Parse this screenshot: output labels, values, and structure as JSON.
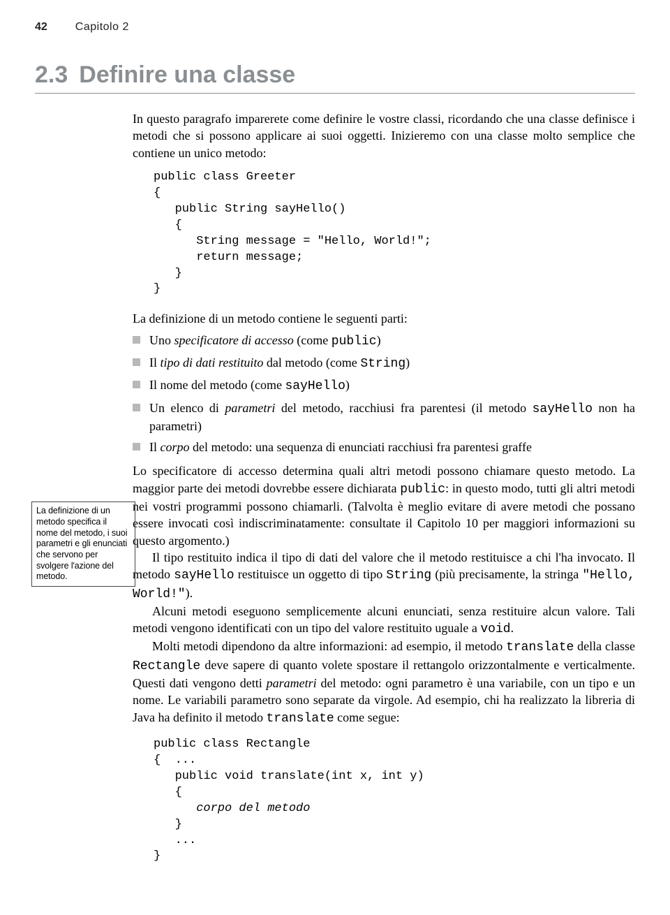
{
  "header": {
    "page_number": "42",
    "chapter": "Capitolo 2"
  },
  "section": {
    "number": "2.3",
    "title": "Definire una classe"
  },
  "intro": "In questo paragrafo imparerete come definire le vostre classi, ricordando che una classe definisce i metodi che si possono applicare ai suoi oggetti. Inizieremo con una classe molto semplice che contiene un unico metodo:",
  "code1": "public class Greeter\n{\n   public String sayHello()\n   {\n      String message = \"Hello, World!\";\n      return message;\n   }\n}",
  "mid": "La definizione di un metodo contiene le seguenti parti:",
  "bullets": {
    "b1": {
      "pre": "Uno ",
      "it": "specificatore di accesso",
      "post": " (come ",
      "mono": "public",
      "end": ")"
    },
    "b2": {
      "pre": "Il ",
      "it": "tipo di dati restituito",
      "post": " dal metodo (come ",
      "mono": "String",
      "end": ")"
    },
    "b3": {
      "pre": "Il nome del metodo (come ",
      "mono": "sayHello",
      "end": ")"
    },
    "b4": {
      "pre": "Un elenco di ",
      "it": "parametri",
      "post": " del metodo, racchiusi fra parentesi (il metodo ",
      "mono": "sayHello",
      "end": " non ha parametri)"
    },
    "b5": {
      "pre": "Il ",
      "it": "corpo",
      "post": " del metodo: una sequenza di enunciati racchiusi fra parentesi graffe"
    }
  },
  "sidebar": "La definizione di un metodo specifica il nome del metodo, i suoi parametri e gli enunciati che servono per svolgere l'azione del metodo.",
  "long": {
    "p1a": "Lo specificatore di accesso determina quali altri metodi possono chiamare questo metodo. La maggior parte dei metodi dovrebbe essere dichiarata ",
    "p1m1": "public",
    "p1b": ": in questo modo, tutti gli altri metodi nei vostri programmi possono chiamarli. (Talvolta è meglio evitare di avere metodi che possano essere invocati così indiscriminatamente: consultate il Capitolo 10 per maggiori informazioni su questo argomento.)",
    "p2a": "Il tipo restituito indica il tipo di dati del valore che il metodo restituisce a chi l'ha invocato. Il metodo ",
    "p2m1": "sayHello",
    "p2b": " restituisce un oggetto di tipo ",
    "p2m2": "String",
    "p2c": " (più precisamente, la stringa ",
    "p2m3": "\"Hello, World!\"",
    "p2d": ").",
    "p3a": "Alcuni metodi eseguono semplicemente alcuni enunciati, senza restituire alcun valore. Tali metodi vengono identificati con un tipo del valore restituito uguale a ",
    "p3m1": "void",
    "p3b": ".",
    "p4a": "Molti metodi dipendono da altre informazioni: ad esempio, il metodo ",
    "p4m1": "translate",
    "p4b": " della classe ",
    "p4m2": "Rectangle",
    "p4c": " deve sapere di quanto volete spostare il rettangolo orizzontalmente e verticalmente. Questi dati vengono detti ",
    "p4it": "parametri",
    "p4d": " del metodo: ogni parametro è una variabile, con un tipo e un nome. Le variabili parametro sono separate da virgole. Ad esempio, chi ha realizzato la libreria di Java ha definito il metodo ",
    "p4m3": "transla­te",
    "p4e": " come segue:"
  },
  "code2": "public class Rectangle\n{  ...\n   public void translate(int x, int y)\n   {\n      corpo del metodo\n   }\n   ...\n}"
}
